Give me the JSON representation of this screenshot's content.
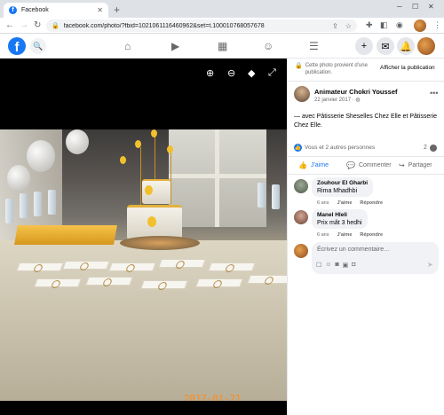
{
  "browser": {
    "tab_title": "Facebook",
    "url": "facebook.com/photo/?fbid=1021061116460962&set=t.100010768057678",
    "icons": [
      "facebook-favicon",
      "close-icon",
      "plus-icon",
      "back-icon",
      "forward-icon",
      "reload-icon",
      "lock-icon",
      "share-icon",
      "star-icon",
      "extensions-icon",
      "sidebar-icon",
      "menu-icon"
    ]
  },
  "fb_header": {
    "logo": "f",
    "nav": [
      "home-icon",
      "video-icon",
      "marketplace-icon",
      "groups-icon",
      "menu-icon"
    ],
    "right": [
      "plus-icon",
      "messenger-icon",
      "bell-icon",
      "avatar"
    ]
  },
  "viewer": {
    "tools": [
      "zoom-in-icon",
      "zoom-out-icon",
      "tag-icon",
      "fullscreen-icon"
    ],
    "timestamp": "2017-01-21 19:10:06"
  },
  "panel": {
    "lock_note": "Cette photo provient d'une publication.",
    "show_publication": "Afficher la publication",
    "author": "Animateur Chokri Youssef",
    "date": "22 janvier 2017 · ",
    "post_text": "— avec Pâtisserie Sheselles Chez Elle et Pâtisserie Chez Elle.",
    "reactions_text": "Vous et 2 autres personnes",
    "comment_count": "2",
    "actions": {
      "like": "J'aime",
      "comment": "Commenter",
      "share": "Partager"
    },
    "comments": [
      {
        "name": "Zouhour El Gharbi",
        "text": "Rima Mhadhbi",
        "age": "6 ans",
        "like": "J'aime",
        "reply": "Répondre"
      },
      {
        "name": "Manel Hleli",
        "text": "Prix mât 3 hedhi",
        "age": "6 ans",
        "like": "J'aime",
        "reply": "Répondre"
      }
    ],
    "comment_placeholder": "Écrivez un commentaire…"
  }
}
